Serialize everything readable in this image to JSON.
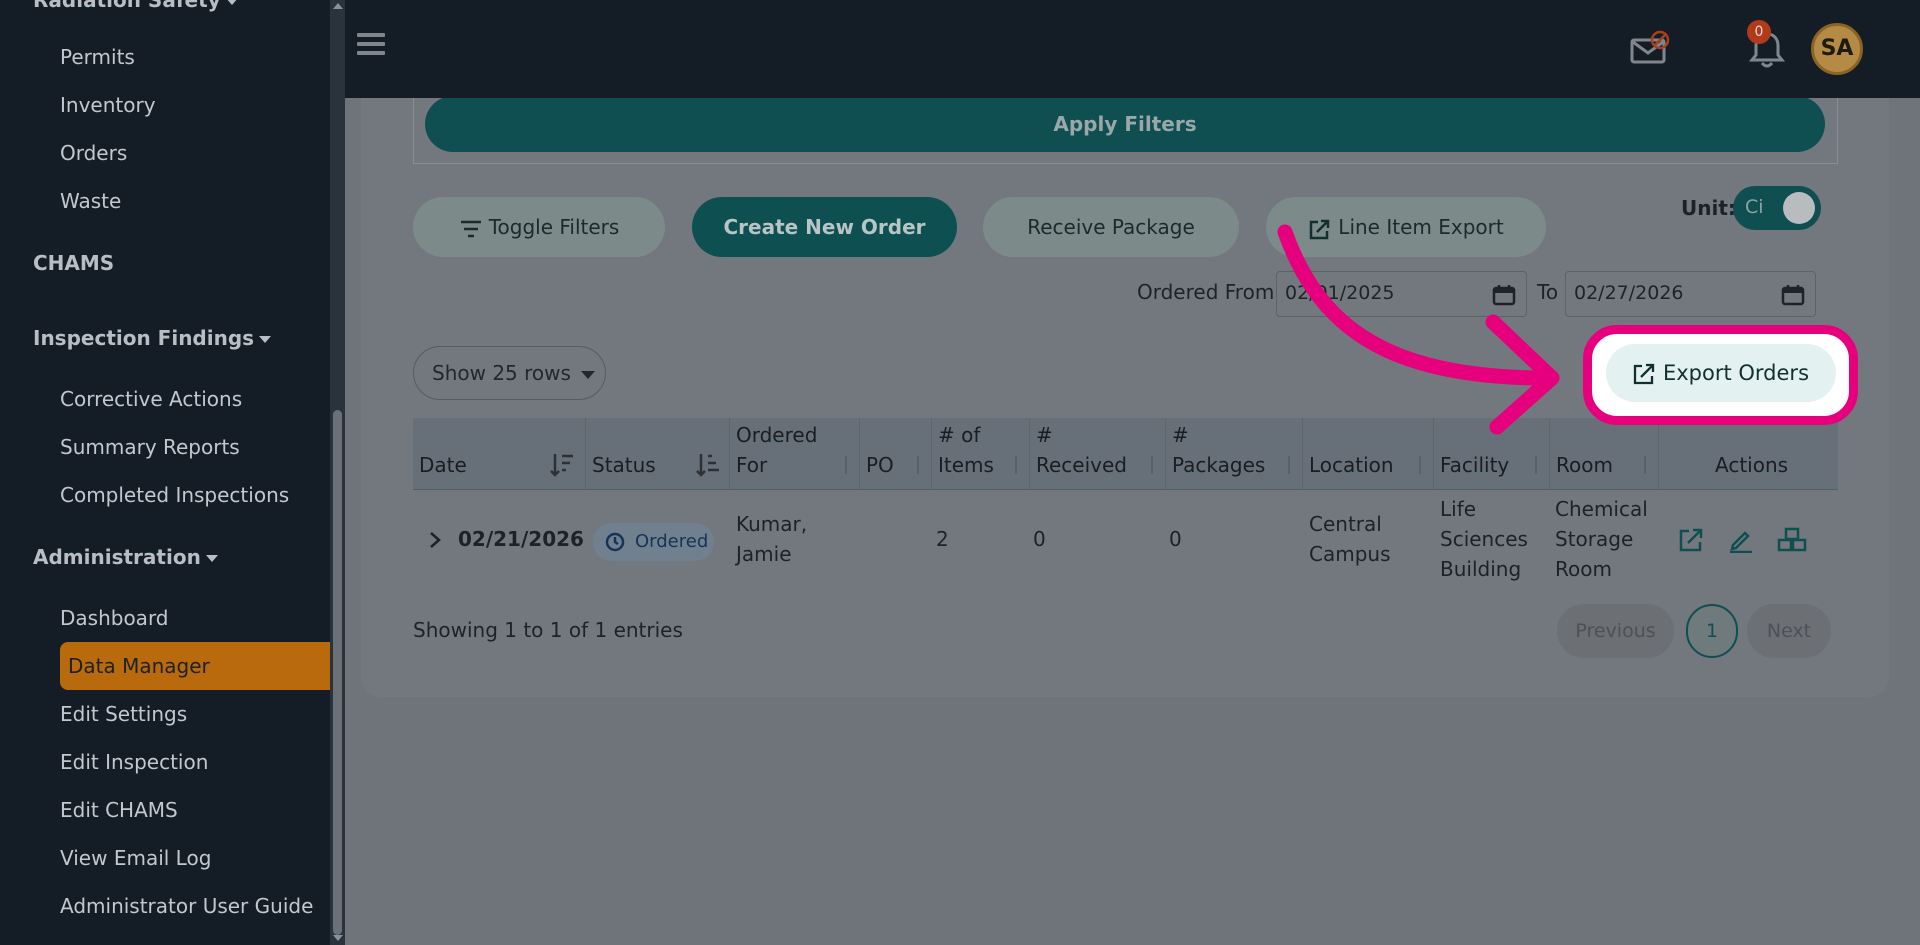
{
  "sidebar": {
    "top_section_partial": "Radiation Safety",
    "items_group1": [
      "Permits",
      "Inventory",
      "Orders",
      "Waste"
    ],
    "chams": "CHAMS",
    "inspection_findings": "Inspection Findings",
    "items_group2": [
      "Corrective Actions",
      "Summary Reports",
      "Completed Inspections"
    ],
    "administration": "Administration",
    "items_group3": [
      "Dashboard",
      "Data Manager",
      "Edit Settings",
      "Edit Inspection",
      "Edit CHAMS",
      "View Email Log",
      "Administrator User Guide"
    ]
  },
  "topbar": {
    "notification_count": "0",
    "avatar_initials": "SA"
  },
  "filters": {
    "apply_label": "Apply Filters",
    "toggle_filters_label": "Toggle Filters",
    "create_order_label": "Create New Order",
    "receive_package_label": "Receive Package",
    "line_item_export_label": "Line Item Export",
    "unit_label": "Unit:",
    "unit_value": "Ci",
    "ordered_from_label": "Ordered From",
    "ordered_from_value": "02/01/2025",
    "to_label": "To",
    "to_value": "02/27/2026"
  },
  "rows_select": "Show 25 rows",
  "export_orders_label": "Export Orders",
  "table": {
    "headers": [
      "Date",
      "Status",
      "Ordered For",
      "PO",
      "# of Items",
      "# Received",
      "# Packages",
      "Location",
      "Facility",
      "Room",
      "Actions"
    ],
    "rows": [
      {
        "date": "02/21/2026",
        "status": "Ordered",
        "ordered_for": "Kumar, Jamie",
        "po": "",
        "items": "2",
        "received": "0",
        "packages": "0",
        "location": "Central Campus",
        "facility": "Life Sciences Building",
        "room": "Chemical Storage Room"
      }
    ]
  },
  "pagination": {
    "showing_text": "Showing 1 to 1 of 1 entries",
    "previous": "Previous",
    "current": "1",
    "next": "Next"
  },
  "colors": {
    "accent_teal": "#0f4e51",
    "highlight_pink": "#e6007e",
    "active_nav": "#b86a0c"
  }
}
